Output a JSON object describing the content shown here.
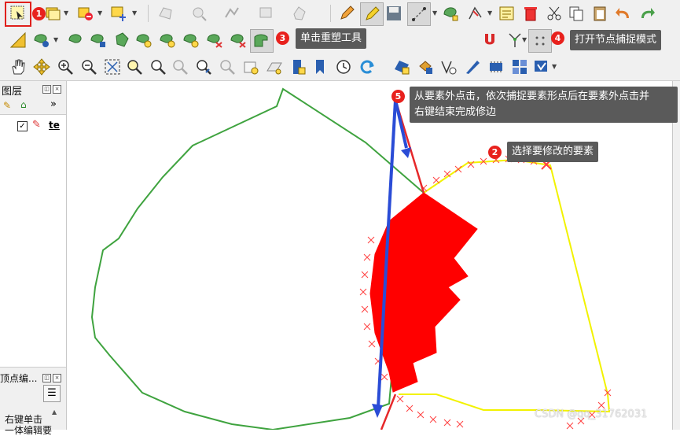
{
  "annotations": {
    "step1": "1",
    "step2": "2",
    "step3": "3",
    "step4": "4",
    "step5": "5",
    "tip2": "选择要修改的要素",
    "tip3": "单击重塑工具",
    "tip4": "打开节点捕捉模式",
    "tip5_line1": "从要素外点击，依次捕捉要素形点后在要素外点击并",
    "tip5_line2": "右键结束完成修边"
  },
  "layers_panel": {
    "title": "图层",
    "expand_label": "»",
    "layer_name": "te",
    "layer_checked": "✓"
  },
  "vertex_panel": {
    "title": "顶点编...",
    "hint_line1": "右键单击",
    "hint_line2": "一体编辑要"
  },
  "watermark": "CSDN @qq_31762031",
  "colors": {
    "green_polygon": "#3fa33f",
    "yellow_polygon": "#f2f200",
    "red_feature": "#ff0000",
    "reshape_line": "#e6282a",
    "blue_arrow": "#2a4cd6",
    "badge": "#e8211d",
    "tooltip": "#5a5a5a"
  },
  "icons": {
    "toolbar1": [
      "select-feature-icon",
      "identify-icon",
      "deselect-icon",
      "select-location-icon",
      "add-polygon-icon",
      "add-point-icon",
      "add-line-icon",
      "add-ring-icon",
      "pencil-icon",
      "toggle-editing-icon",
      "save-edits-icon",
      "digitize-icon",
      "add-feature-icon",
      "vertex-tool-icon",
      "edit-attributes-icon",
      "delete-icon",
      "cut-icon",
      "copy-icon",
      "paste-icon",
      "undo-icon",
      "redo-icon"
    ],
    "toolbar2": [
      "measure-icon",
      "add-part-icon",
      "rotate-icon",
      "simplify-icon",
      "split-icon",
      "merge-icon",
      "offset-icon",
      "fill-ring-icon",
      "delete-part-icon",
      "reshape-icon",
      "snapping-magnet-icon",
      "snap-vertex-icon"
    ],
    "toolbar3": [
      "pan-icon",
      "pan-to-selection-icon",
      "zoom-in-icon",
      "zoom-out-icon",
      "zoom-full-icon",
      "zoom-layer-icon",
      "zoom-selection-icon",
      "zoom-native-icon",
      "zoom-last-icon",
      "zoom-next-icon",
      "new-bookmark-icon",
      "show-bookmarks-icon",
      "temporal-icon",
      "refresh-icon",
      "label-icon",
      "rule-label-icon",
      "vertex-label-icon",
      "diagram-icon",
      "pin-labels-icon",
      "show-hide-icon",
      "move-label-icon"
    ]
  }
}
